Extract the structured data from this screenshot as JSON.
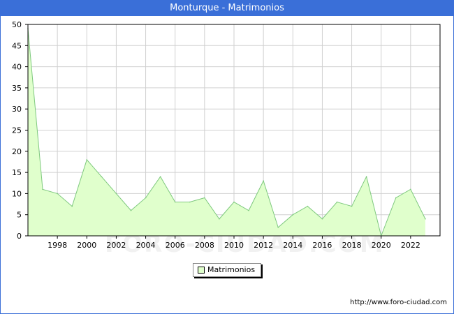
{
  "title": "Monturque - Matrimonios",
  "source": "http://www.foro-ciudad.com",
  "watermark": "FORO-CIUDAD.COM",
  "legend": {
    "label": "Matrimonios"
  },
  "colors": {
    "title_bar": "#3a6fd8",
    "fill": "#e0ffcc",
    "line": "#7fc97f",
    "grid": "#d0d0d0"
  },
  "chart_data": {
    "type": "area",
    "x": [
      1996,
      1997,
      1998,
      1999,
      2000,
      2001,
      2002,
      2003,
      2004,
      2005,
      2006,
      2007,
      2008,
      2009,
      2010,
      2011,
      2012,
      2013,
      2014,
      2015,
      2016,
      2017,
      2018,
      2019,
      2020,
      2021,
      2022,
      2023
    ],
    "series": [
      {
        "name": "Matrimonios",
        "values": [
          49,
          11,
          10,
          7,
          18,
          14,
          10,
          6,
          9,
          14,
          8,
          8,
          9,
          4,
          8,
          6,
          13,
          2,
          5,
          7,
          4,
          8,
          7,
          14,
          0,
          9,
          11,
          4
        ]
      }
    ],
    "x_tick_labels": [
      "1998",
      "2000",
      "2002",
      "2004",
      "2006",
      "2008",
      "2010",
      "2012",
      "2014",
      "2016",
      "2018",
      "2020",
      "2022"
    ],
    "y_tick_labels": [
      "0",
      "5",
      "10",
      "15",
      "20",
      "25",
      "30",
      "35",
      "40",
      "45",
      "50"
    ],
    "ylim": [
      0,
      50
    ],
    "xlim": [
      1996,
      2024
    ],
    "grid": true,
    "legend_position": "bottom-center"
  }
}
